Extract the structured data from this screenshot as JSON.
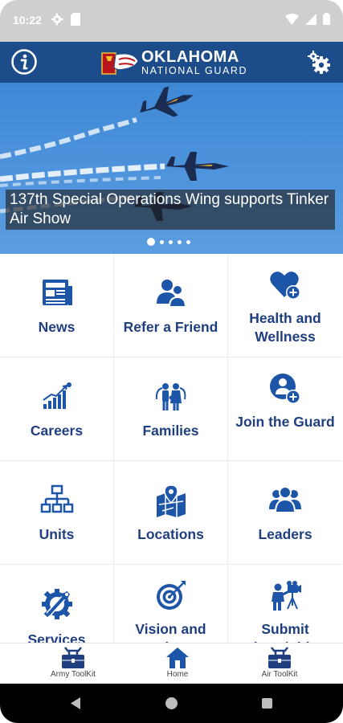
{
  "status_bar": {
    "time": "10:22",
    "icons": [
      "gear-icon",
      "sd-card-icon",
      "wifi-icon",
      "cellular-icon",
      "battery-icon"
    ]
  },
  "header": {
    "logo_line1": "OKLAHOMA",
    "logo_line2": "NATIONAL GUARD",
    "info_icon": "info-icon",
    "settings_icon": "gears-icon"
  },
  "hero": {
    "caption": "137th Special Operations Wing supports Tinker Air Show",
    "slide_count": 5,
    "active_slide": 1
  },
  "menu": {
    "tiles": [
      {
        "label": "News",
        "icon": "newspaper-icon"
      },
      {
        "label": "Refer a Friend",
        "icon": "people-icon"
      },
      {
        "label": "Health and Wellness",
        "icon": "heart-plus-icon"
      },
      {
        "label": "Careers",
        "icon": "growth-chart-icon"
      },
      {
        "label": "Families",
        "icon": "family-icon"
      },
      {
        "label": "Join the Guard",
        "icon": "add-user-icon"
      },
      {
        "label": "Units",
        "icon": "org-chart-icon"
      },
      {
        "label": "Locations",
        "icon": "map-pin-icon"
      },
      {
        "label": "Leaders",
        "icon": "group-icon"
      },
      {
        "label": "Services",
        "icon": "wrench-gear-icon"
      },
      {
        "label": "Vision and Values",
        "icon": "target-icon"
      },
      {
        "label": "Submit Photo/Video",
        "icon": "camera-person-icon"
      }
    ]
  },
  "bottom_nav": {
    "items": [
      {
        "label": "Army ToolKit",
        "icon": "toolbox-icon"
      },
      {
        "label": "Home",
        "icon": "home-icon"
      },
      {
        "label": "Air ToolKit",
        "icon": "toolbox-icon"
      }
    ]
  },
  "colors": {
    "header_bg": "#1d4c8a",
    "tile_text": "#1f3f80",
    "icon_blue": "#1d55a8"
  }
}
